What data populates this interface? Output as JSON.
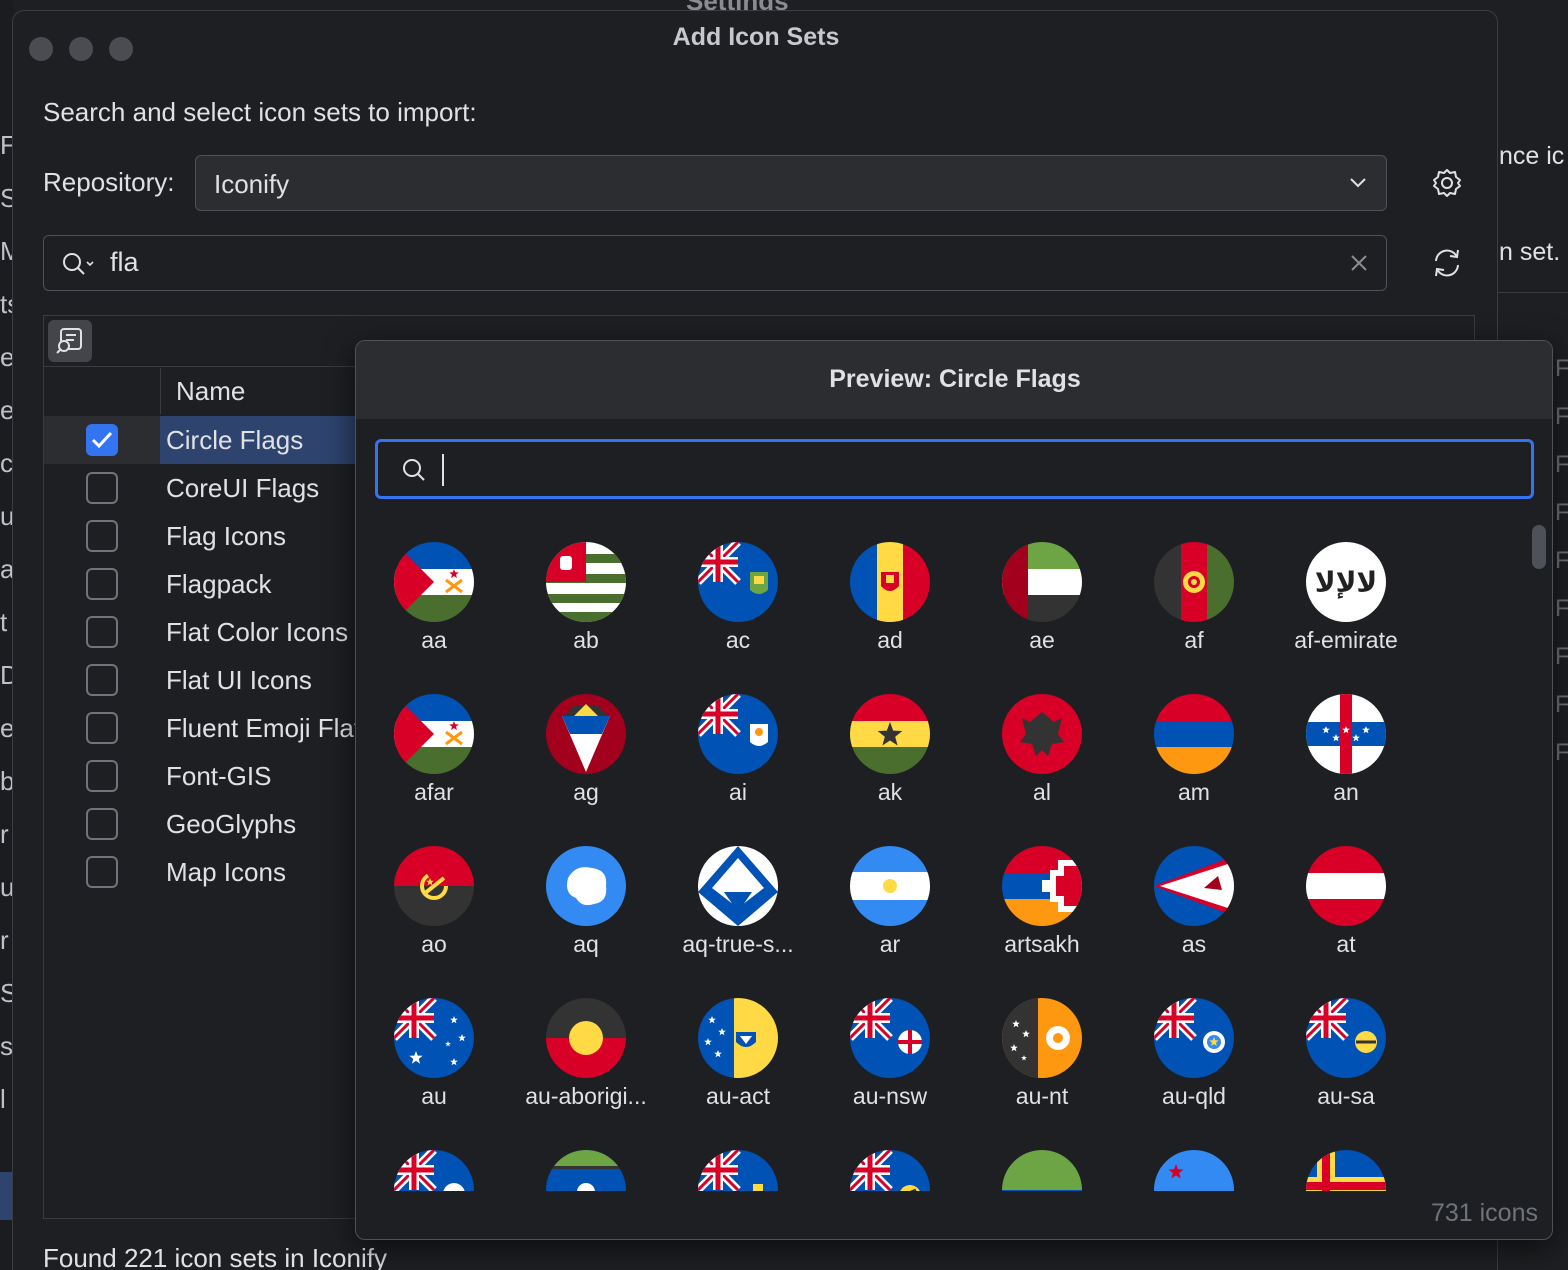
{
  "background": {
    "title": "Settings",
    "right_texts": [
      "nce ic",
      "n set."
    ],
    "right_column_snippets": [
      "Fa",
      "Fa",
      "Fa",
      "Fa",
      "Fa",
      "Fa",
      "Fa",
      "Fa",
      "Fa"
    ],
    "left_letters": [
      "F",
      "S",
      "M",
      "ts",
      "e",
      "e",
      "c",
      "u",
      "a",
      "t",
      "D",
      "e",
      "b",
      "r",
      "u",
      "r",
      "S",
      "s",
      "l"
    ]
  },
  "dialog": {
    "title": "Add Icon Sets",
    "instruction": "Search and select icon sets to import:",
    "repository_label": "Repository:",
    "repository_value": "Iconify",
    "search_value": "fla",
    "column_name": "Name",
    "footer": "Found 221 icon sets in Iconify",
    "icon_sets": [
      {
        "label": "Circle Flags",
        "checked": true,
        "selected": true
      },
      {
        "label": "CoreUI Flags",
        "checked": false,
        "selected": false
      },
      {
        "label": "Flag Icons",
        "checked": false,
        "selected": false
      },
      {
        "label": "Flagpack",
        "checked": false,
        "selected": false
      },
      {
        "label": "Flat Color Icons",
        "checked": false,
        "selected": false
      },
      {
        "label": "Flat UI Icons",
        "checked": false,
        "selected": false
      },
      {
        "label": "Fluent Emoji Flat",
        "checked": false,
        "selected": false
      },
      {
        "label": "Font-GIS",
        "checked": false,
        "selected": false
      },
      {
        "label": "GeoGlyphs",
        "checked": false,
        "selected": false
      },
      {
        "label": "Map Icons",
        "checked": false,
        "selected": false
      }
    ]
  },
  "preview": {
    "title": "Preview: Circle Flags",
    "search_value": "",
    "count_label": "731 icons",
    "icons": [
      {
        "label": "aa",
        "flag": "aa"
      },
      {
        "label": "ab",
        "flag": "ab"
      },
      {
        "label": "ac",
        "flag": "ac"
      },
      {
        "label": "ad",
        "flag": "ad"
      },
      {
        "label": "ae",
        "flag": "ae"
      },
      {
        "label": "af",
        "flag": "af"
      },
      {
        "label": "af-emirate",
        "flag": "af-emirate"
      },
      {
        "label": "afar",
        "flag": "aa"
      },
      {
        "label": "ag",
        "flag": "ag"
      },
      {
        "label": "ai",
        "flag": "ai"
      },
      {
        "label": "ak",
        "flag": "ak"
      },
      {
        "label": "al",
        "flag": "al"
      },
      {
        "label": "am",
        "flag": "am"
      },
      {
        "label": "an",
        "flag": "an"
      },
      {
        "label": "ao",
        "flag": "ao"
      },
      {
        "label": "aq",
        "flag": "aq"
      },
      {
        "label": "aq-true-s...",
        "flag": "aq-true"
      },
      {
        "label": "ar",
        "flag": "ar"
      },
      {
        "label": "artsakh",
        "flag": "artsakh"
      },
      {
        "label": "as",
        "flag": "as"
      },
      {
        "label": "at",
        "flag": "at"
      },
      {
        "label": "au",
        "flag": "au"
      },
      {
        "label": "au-aborigi...",
        "flag": "au-aboriginal"
      },
      {
        "label": "au-act",
        "flag": "au-act"
      },
      {
        "label": "au-nsw",
        "flag": "au-nsw"
      },
      {
        "label": "au-nt",
        "flag": "au-nt"
      },
      {
        "label": "au-qld",
        "flag": "au-qld"
      },
      {
        "label": "au-sa",
        "flag": "au-sa"
      },
      {
        "label": "",
        "flag": "au-tas"
      },
      {
        "label": "",
        "flag": "au-torres"
      },
      {
        "label": "",
        "flag": "au-vic"
      },
      {
        "label": "",
        "flag": "au-wa"
      },
      {
        "label": "",
        "flag": "aw-green"
      },
      {
        "label": "",
        "flag": "aw-blue"
      },
      {
        "label": "",
        "flag": "ax"
      }
    ]
  }
}
